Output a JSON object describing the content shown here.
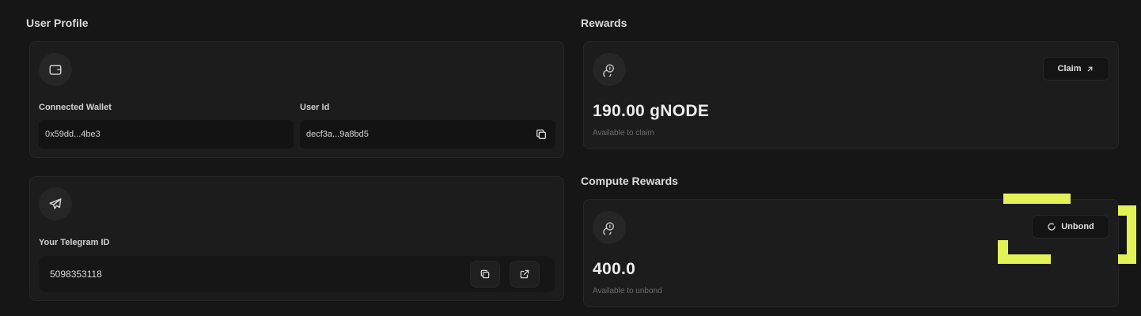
{
  "user_profile": {
    "title": "User Profile",
    "wallet_icon": "wallet-icon",
    "connected_wallet_label": "Connected Wallet",
    "connected_wallet_value": "0x59dd...4be3",
    "user_id_label": "User Id",
    "user_id_value": "decf3a...9a8bd5",
    "copy_icon": "copy-icon",
    "telegram_icon": "telegram-icon",
    "telegram_label": "Your Telegram ID",
    "telegram_value": "5098353118",
    "external_link_icon": "external-link-icon"
  },
  "rewards": {
    "title": "Rewards",
    "coin_icon": "coin-icon",
    "claim_label": "Claim",
    "claim_icon": "arrow-up-right-icon",
    "amount": "190.00 gNODE",
    "amount_caption": "Available to claim"
  },
  "compute_rewards": {
    "title": "Compute Rewards",
    "coin_icon": "coin-icon",
    "unbond_label": "Unbond",
    "unbond_icon": "refresh-icon",
    "amount": "400.0",
    "amount_caption": "Available to unbond"
  },
  "colors": {
    "background": "#161616",
    "card": "#1c1c1c",
    "highlight": "#e3f257",
    "muted_text": "#6b6b6b"
  }
}
